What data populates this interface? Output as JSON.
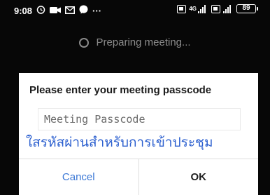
{
  "status_bar": {
    "time": "9:08",
    "more_dots": "···",
    "battery": "89",
    "lte_label": "4G",
    "left_icons": [
      "timer-icon",
      "video-icon",
      "mail-icon",
      "messenger-icon"
    ]
  },
  "background": {
    "preparing_text": "Preparing meeting..."
  },
  "dialog": {
    "title": "Please enter your meeting passcode",
    "passcode_placeholder": "Meeting Passcode",
    "passcode_value": "",
    "annotation": "ใสรหัสผ่านสำหรับการเข้าประชุม",
    "cancel_label": "Cancel",
    "ok_label": "OK"
  },
  "colors": {
    "background": "#070707",
    "cancel": "#3b78d6",
    "annotation": "#2b5fcf"
  }
}
